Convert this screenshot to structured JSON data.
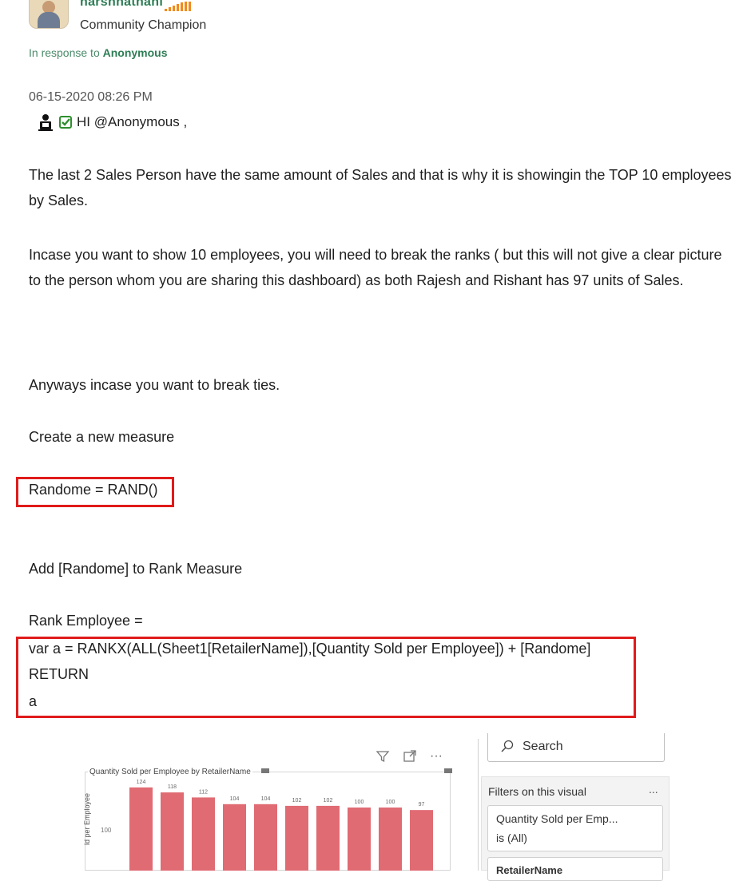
{
  "post_header": {
    "username": "harshnathani",
    "rank_title": "Community Champion",
    "in_response_prefix": "In response to",
    "in_response_user": "Anonymous",
    "rank_color": "#f08a1c",
    "accent_color": "#2e7d55"
  },
  "post": {
    "timestamp": "06-15-2020 08:26 PM",
    "greeting": "HI @Anonymous ,",
    "paragraph1": "The last 2 Sales Person have the same amount of Sales and that is why it is showingin the TOP 10 employees by Sales.",
    "paragraph2": "Incase you want to show 10 employees, you will need to break the ranks ( but this will not give a clear picture to the person whom you are sharing this dashboard) as both Rajesh and Rishant has 97 units of Sales.",
    "paragraph3": "Anyways incase you want to break ties.",
    "paragraph4": "Create a new measure",
    "code1": "Randome = RAND()",
    "paragraph5": "Add [Randome] to Rank Measure",
    "paragraph6": "Rank Employee =",
    "code2_line1": "var a = RANKX(ALL(Sheet1[RetailerName]),[Quantity Sold per Employee]) + [Randome]",
    "code2_line2": "RETURN",
    "code2_line3": "a",
    "highlight_color": "#e01b1b"
  },
  "chart_data": {
    "type": "bar",
    "title": "Quantity Sold per Employee by RetailerName",
    "ylabel": "ld per Employee",
    "ytick_visible": "100",
    "values": [
      124,
      118,
      112,
      104,
      104,
      102,
      102,
      100,
      100,
      97
    ],
    "value_labels": [
      "124",
      "118",
      "112",
      "104",
      "104",
      "102",
      "102",
      "100",
      "100",
      "97"
    ],
    "bar_color": "#e06b73"
  },
  "filter_pane": {
    "search_placeholder": "Search",
    "heading": "Filters on this visual",
    "more": "...",
    "filter_name": "Quantity Sold per Emp...",
    "filter_value": "is (All)",
    "second_filter": "RetailerName"
  }
}
